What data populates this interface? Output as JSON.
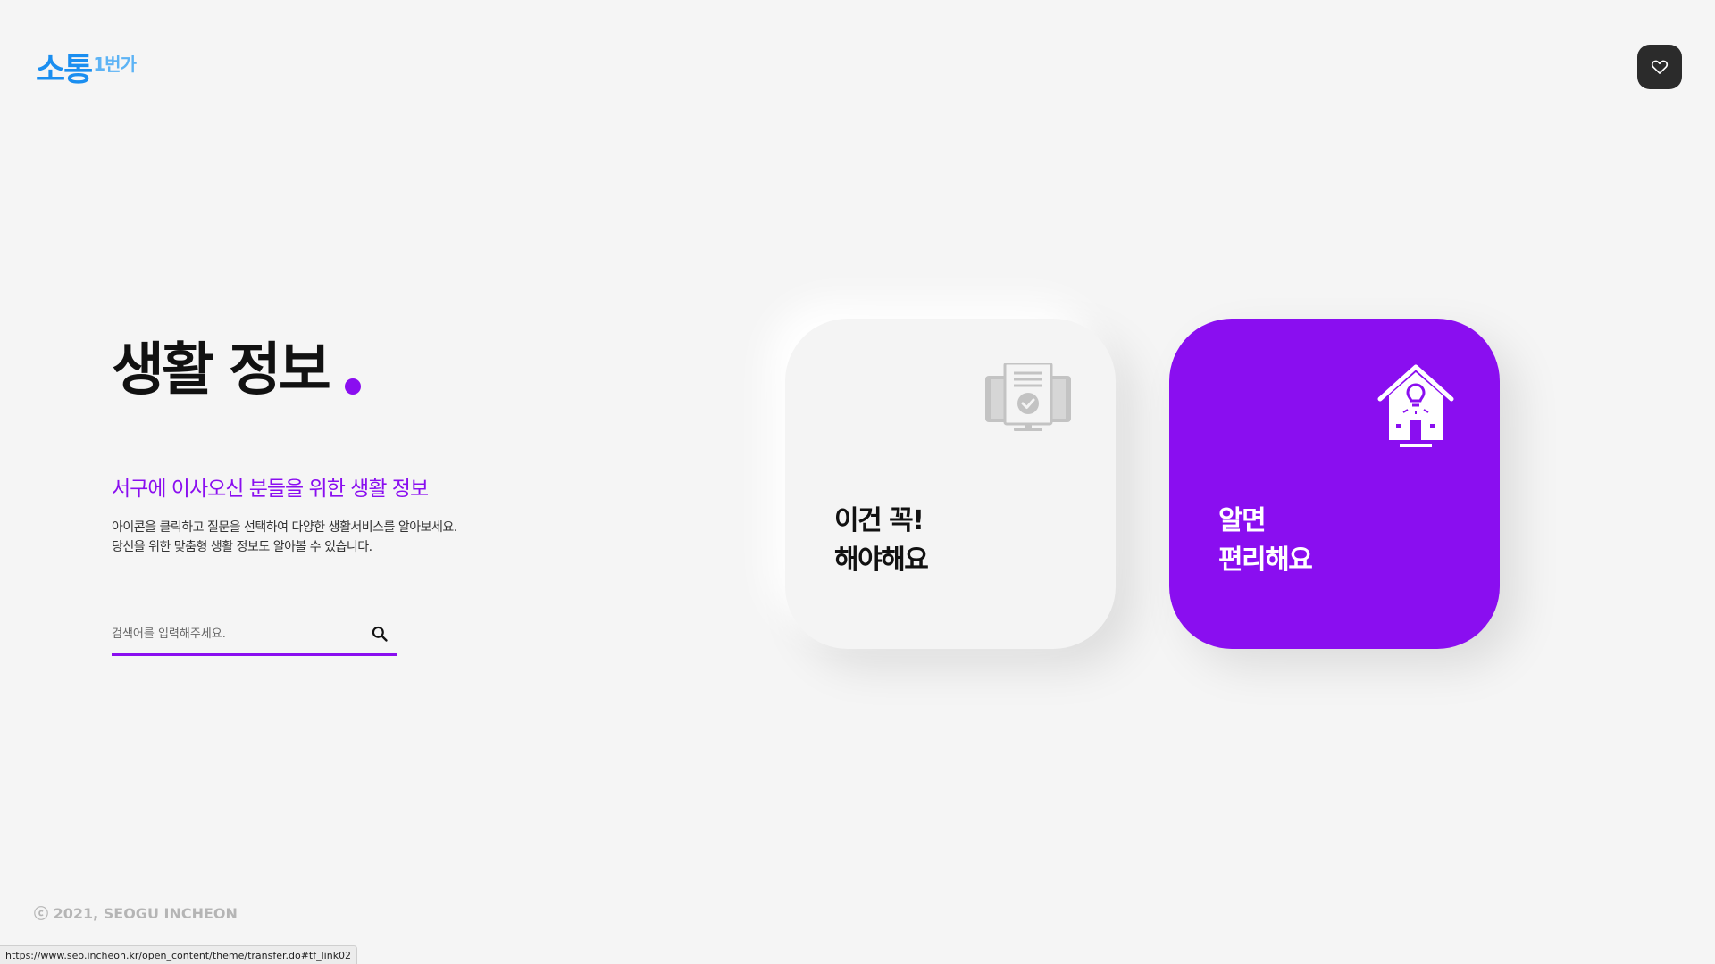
{
  "logo": {
    "main": "소통",
    "sub": "1번가"
  },
  "favorite": {
    "icon": "heart-icon"
  },
  "hero": {
    "title": "생활 정보",
    "subtitle": "서구에 이사오신 분들을 위한 생활 정보",
    "description_line1": "아이콘을 클릭하고 질문을 선택하여 다양한 생활서비스를 알아보세요.",
    "description_line2": "당신을 위한 맞춤형 생활 정보도 알아볼 수 있습니다."
  },
  "search": {
    "placeholder": "검색어를 입력해주세요.",
    "value": "",
    "icon": "search-icon"
  },
  "cards": [
    {
      "line1": "이건 꼭!",
      "line2": "해야해요",
      "icon": "document-monitor-icon",
      "color": "#f4f4f4"
    },
    {
      "line1": "알면",
      "line2": "편리해요",
      "icon": "house-lightbulb-icon",
      "color": "#8a0ef0"
    }
  ],
  "footer": {
    "copyright": "ⓒ 2021, SEOGU INCHEON"
  },
  "status_bar": {
    "url": "https://www.seo.incheon.kr/open_content/theme/transfer.do#tf_link02"
  },
  "colors": {
    "accent": "#8a0ef0",
    "logo": "#1a8ef0",
    "background": "#f5f5f5"
  }
}
